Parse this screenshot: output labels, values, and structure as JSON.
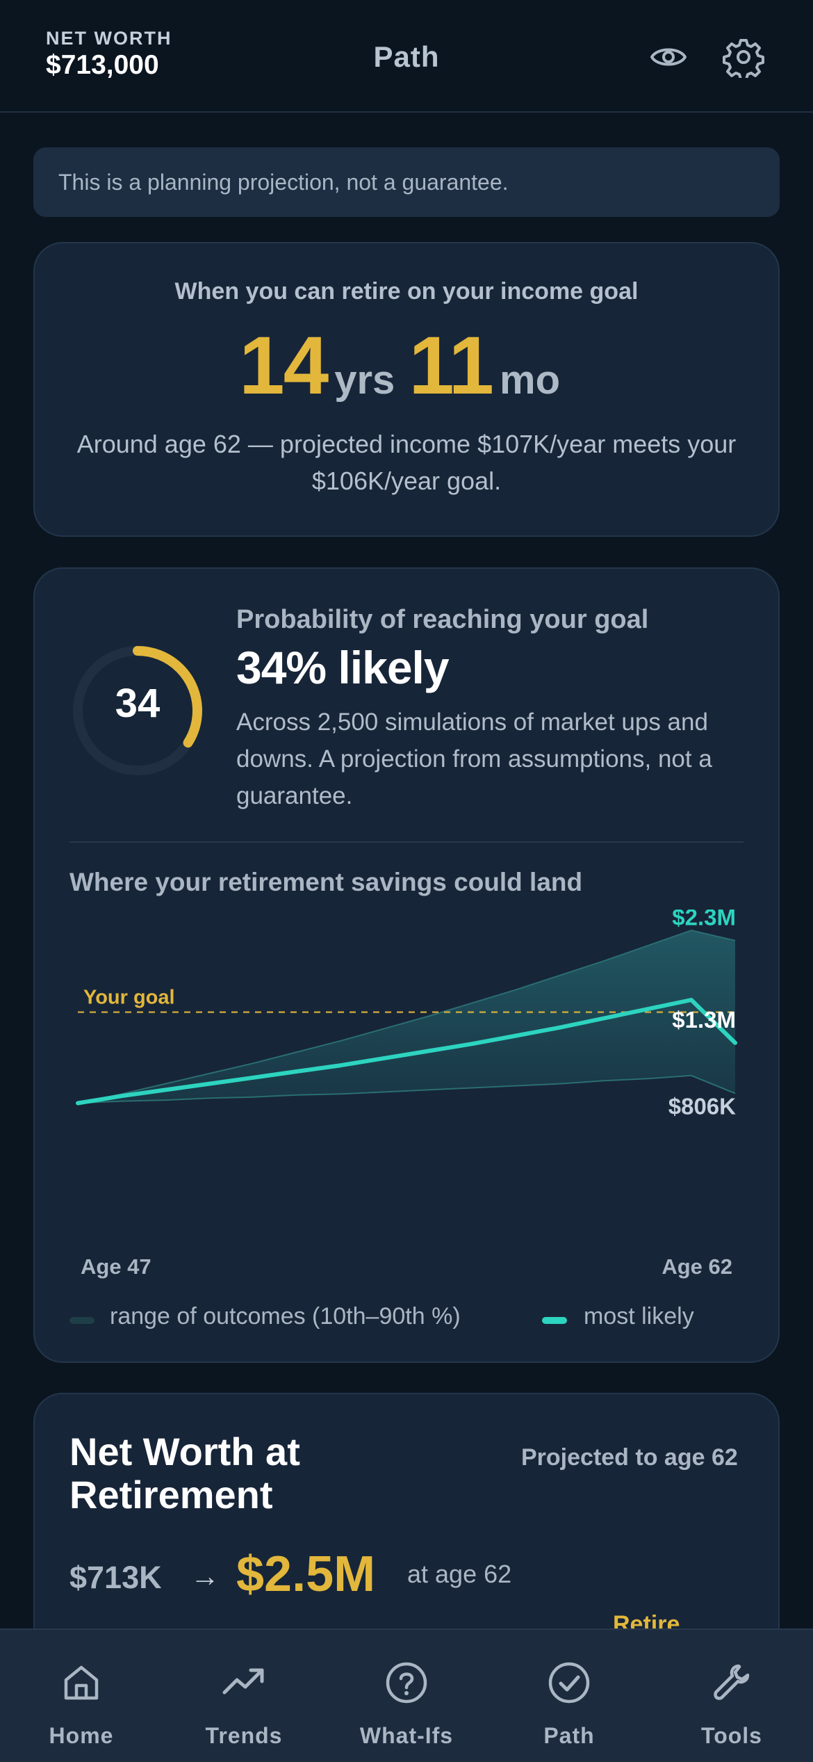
{
  "header": {
    "net_worth_label": "NET WORTH",
    "net_worth_value": "$713,000",
    "title": "Path",
    "icons": [
      "eye-icon",
      "gear-icon"
    ]
  },
  "notice": {
    "text": "This is a planning projection, not a guarantee."
  },
  "retire_card": {
    "title": "When you can retire on your income goal",
    "years": "14",
    "years_unit": "yrs",
    "months": "11",
    "months_unit": "mo",
    "subtitle": "Around age 62 — projected income $107K/year meets your $106K/year goal."
  },
  "probability_card": {
    "ring_value": "34",
    "ring_fraction": 0.34,
    "label": "Probability of reaching your goal",
    "value": "34% likely",
    "description": "Across 2,500 simulations of market ups and downs. A projection from assumptions, not a guarantee.",
    "chart_title": "Where your retirement savings could land",
    "age_start": "Age 47",
    "age_end": "Age 62",
    "legend_range": "range of outcomes (10th–90th %)",
    "legend_likely": "most likely"
  },
  "chart_data": {
    "type": "area",
    "title": "Where your retirement savings could land",
    "x": [
      47,
      48,
      49,
      50,
      51,
      52,
      53,
      54,
      55,
      56,
      57,
      58,
      59,
      60,
      61,
      62
    ],
    "x_tick_labels": [
      "Age 47",
      "Age 62"
    ],
    "series": [
      {
        "name": "range of outcomes (10th–90th %)",
        "role": "p10",
        "values": [
          0.71,
          0.73,
          0.74,
          0.76,
          0.77,
          0.79,
          0.8,
          0.82,
          0.84,
          0.86,
          0.88,
          0.9,
          0.93,
          0.95,
          0.98,
          0.806
        ]
      },
      {
        "name": "most likely",
        "role": "median",
        "values": [
          0.71,
          0.78,
          0.84,
          0.9,
          0.96,
          1.02,
          1.08,
          1.15,
          1.22,
          1.29,
          1.37,
          1.45,
          1.54,
          1.63,
          1.72,
          1.3
        ]
      },
      {
        "name": "range of outcomes (10th–90th %)",
        "role": "p90",
        "values": [
          0.71,
          0.8,
          0.9,
          1.0,
          1.1,
          1.21,
          1.32,
          1.44,
          1.56,
          1.69,
          1.82,
          1.96,
          2.1,
          2.25,
          2.4,
          2.3
        ]
      }
    ],
    "end_labels": [
      "$2.3M",
      "$1.3M",
      "$806K"
    ],
    "goal_label": "Your goal",
    "goal_value": 1.6,
    "colors": {
      "range": "#1f4a55",
      "median": "#2dd4bf",
      "goal": "#e2b73b"
    }
  },
  "net_worth_card": {
    "title": "Net Worth at Retirement",
    "note": "Projected to age 62",
    "from_value": "$713K",
    "arrow": "→",
    "to_value": "$2.5M",
    "at_age": "at age 62",
    "peek_label": "Retire"
  },
  "tabbar": {
    "items": [
      {
        "label": "Home",
        "icon": "home-icon"
      },
      {
        "label": "Trends",
        "icon": "trending-up-icon"
      },
      {
        "label": "What-Ifs",
        "icon": "question-circle-icon"
      },
      {
        "label": "Path",
        "icon": "check-circle-icon"
      },
      {
        "label": "Tools",
        "icon": "wrench-icon"
      }
    ]
  }
}
